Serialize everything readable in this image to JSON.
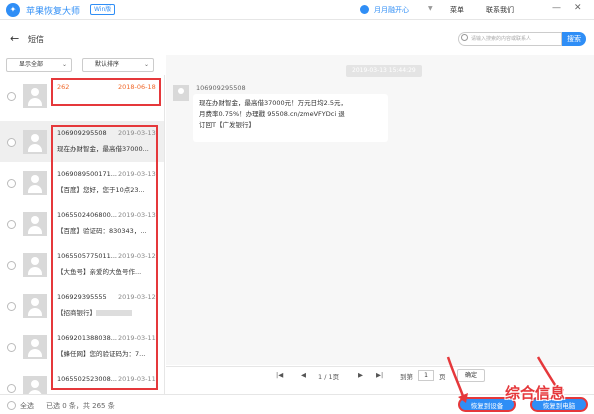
{
  "app": {
    "title": "苹果恢复大师",
    "badge": "Win版"
  },
  "header": {
    "user": "月月融开心",
    "menu": "菜单",
    "contact": "联系我们"
  },
  "window_controls": {
    "minimize": "—",
    "close": "✕"
  },
  "nav": {
    "title": "短信",
    "search_placeholder": "请输入搜索的内容或联系人",
    "search_button": "搜索"
  },
  "filters": {
    "show_all": "显示全部",
    "sort": "默认排序"
  },
  "messages": [
    {
      "sender": "262",
      "date": "2018-06-18",
      "preview": ""
    },
    {
      "sender": "1069092955​08",
      "date": "2019-03-13",
      "preview": "现在办财智金，最高借37000..."
    },
    {
      "sender": "106908950017​1...",
      "date": "2019-03-13",
      "preview": "【百度】您好，您于10点23..."
    },
    {
      "sender": "10655024068​00...",
      "date": "2019-03-13",
      "preview": "【百度】验证码：830343，..."
    },
    {
      "sender": "10655057750​11...",
      "date": "2019-03-12",
      "preview": "【大鱼号】亲爱的大鱼号作..."
    },
    {
      "sender": "106929395555",
      "date": "2019-03-12",
      "preview": "【招商银行】"
    },
    {
      "sender": "10692013880​38...",
      "date": "2019-03-11",
      "preview": "【蜂任网】您的验证码为：7..."
    },
    {
      "sender": "10655025230​08...",
      "date": "2019-03-11",
      "preview": ""
    }
  ],
  "detail": {
    "date_header": "2019-03-13 15:44:29",
    "sender": "106909295508",
    "lines": [
      "现在办财智金，最高借37000元！万元日均2.5元，",
      "月费率0.75%！办理戳 95508.cn/zmeVFYDci 退",
      "订回T【广发银行】"
    ]
  },
  "pager": {
    "current": "1 / 1页",
    "goto_label": "到第",
    "page_value": "1",
    "page_unit": "页",
    "confirm": "确定"
  },
  "footer": {
    "select_all": "全选",
    "selected": "已选 0 条，共 265 条",
    "recover_device": "恢复到设备",
    "recover_pc": "恢复到电脑"
  },
  "watermark": "综合信息",
  "colors": {
    "accent": "#2f8ef6",
    "highlight": "#e5383b",
    "orange": "#f0682a"
  }
}
